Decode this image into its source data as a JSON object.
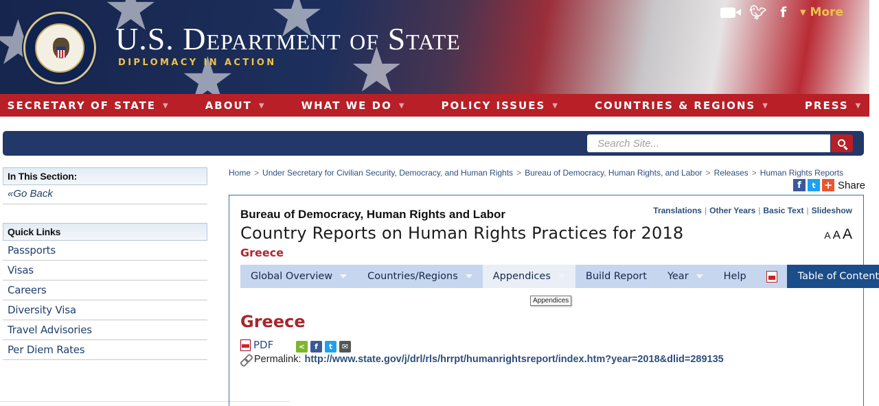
{
  "header": {
    "title_part1": "U.S. D",
    "title_part2": "EPARTMENT",
    "title_of": "OF",
    "title_part3": "S",
    "title_part4": "TATE",
    "tagline": "DIPLOMACY IN ACTION",
    "social": {
      "more_label": "More"
    }
  },
  "main_nav": [
    {
      "label": "SECRETARY OF STATE"
    },
    {
      "label": "ABOUT"
    },
    {
      "label": "WHAT WE DO"
    },
    {
      "label": "POLICY ISSUES"
    },
    {
      "label": "COUNTRIES & REGIONS"
    },
    {
      "label": "PRESS"
    }
  ],
  "search": {
    "placeholder": "Search Site..."
  },
  "sidebar": {
    "section_heading": "In This Section:",
    "go_back": "Go Back",
    "quick_links_heading": "Quick Links",
    "quick_links": [
      {
        "label": "Passports"
      },
      {
        "label": "Visas"
      },
      {
        "label": "Careers"
      },
      {
        "label": "Diversity Visa"
      },
      {
        "label": "Travel Advisories"
      },
      {
        "label": "Per Diem Rates"
      }
    ]
  },
  "breadcrumb": [
    {
      "label": "Home"
    },
    {
      "label": "Under Secretary for Civilian Security, Democracy, and Human Rights"
    },
    {
      "label": "Bureau of Democracy, Human Rights, and Labor"
    },
    {
      "label": "Releases"
    },
    {
      "label": "Human Rights Reports"
    }
  ],
  "share_label": "Share",
  "content": {
    "bureau": "Bureau of Democracy, Human Rights and Labor",
    "title": "Country Reports on Human Rights Practices for 2018",
    "country": "Greece",
    "top_links": [
      {
        "label": "Translations"
      },
      {
        "label": "Other Years"
      },
      {
        "label": "Basic Text"
      },
      {
        "label": "Slideshow"
      }
    ],
    "text_size": [
      "A",
      "A",
      "A"
    ],
    "tabs": [
      {
        "label": "Global Overview"
      },
      {
        "label": "Countries/Regions"
      },
      {
        "label": "Appendices"
      },
      {
        "label": "Build Report"
      },
      {
        "label": "Year"
      },
      {
        "label": "Help"
      },
      {
        "label": "Table of Contents"
      }
    ],
    "tooltip": "Appendices",
    "heading": "Greece",
    "pdf_label": "PDF",
    "permalink_label": "Permalink:",
    "permalink_url": "http://www.state.gov/j/drl/rls/hrrpt/humanrightsreport/index.htm?year=2018&dlid=289135"
  }
}
